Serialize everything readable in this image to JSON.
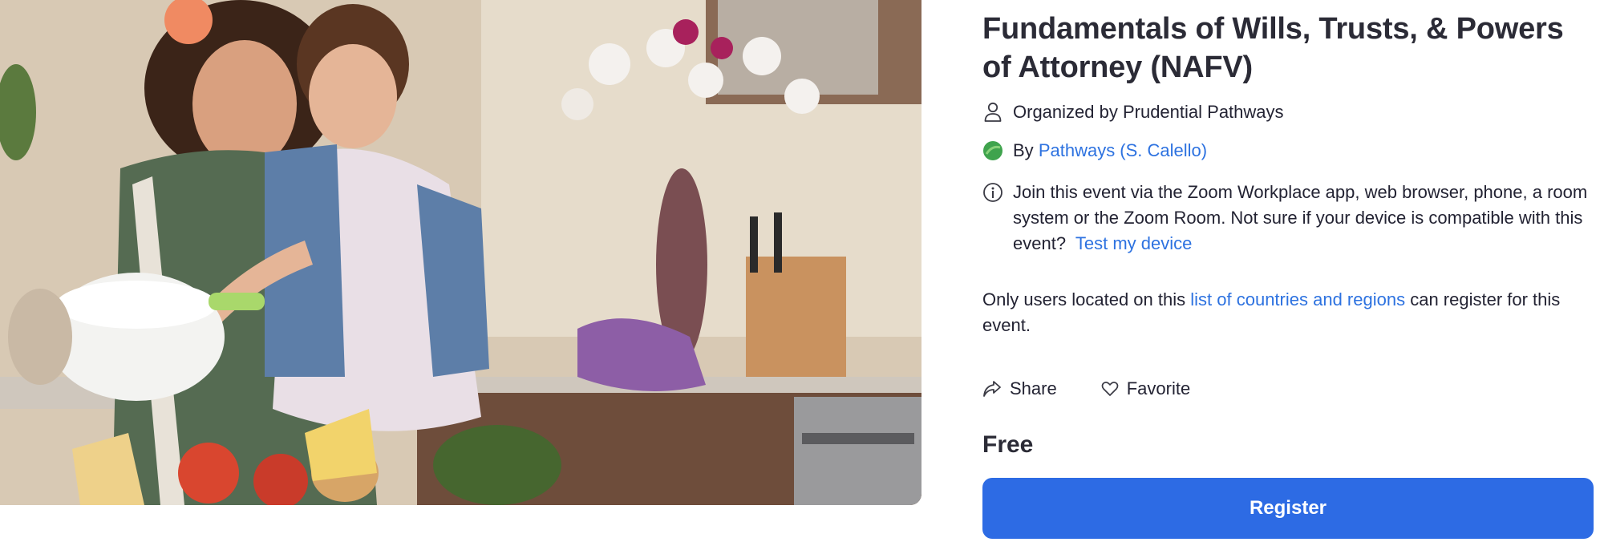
{
  "hero": {
    "image_description": "mother and daughter cooking in kitchen"
  },
  "event": {
    "title": "Fundamentals of Wills, Trusts, & Powers of Attorney (NAFV)",
    "organizer_text": "Organized by Prudential Pathways",
    "host_prefix": "By",
    "host_link": "Pathways (S. Calello)",
    "zoom_text": "Join this event via the Zoom Workplace app, web browser, phone, a room system or the Zoom Room. Not sure if your device is compatible with this event?",
    "test_device_link": "Test my device",
    "region_prefix": "Only users located on this",
    "region_link": "list of countries and regions",
    "region_suffix": "can register for this event.",
    "share_label": "Share",
    "favorite_label": "Favorite",
    "price": "Free",
    "register_label": "Register"
  },
  "colors": {
    "link": "#2d72e0",
    "register_bg": "#2d6be4",
    "host_avatar": "#3fa34d"
  },
  "icons": {
    "organizer": "person-icon",
    "host": "green-avatar-icon",
    "info": "info-icon",
    "share": "share-arrow-icon",
    "favorite": "heart-icon"
  }
}
